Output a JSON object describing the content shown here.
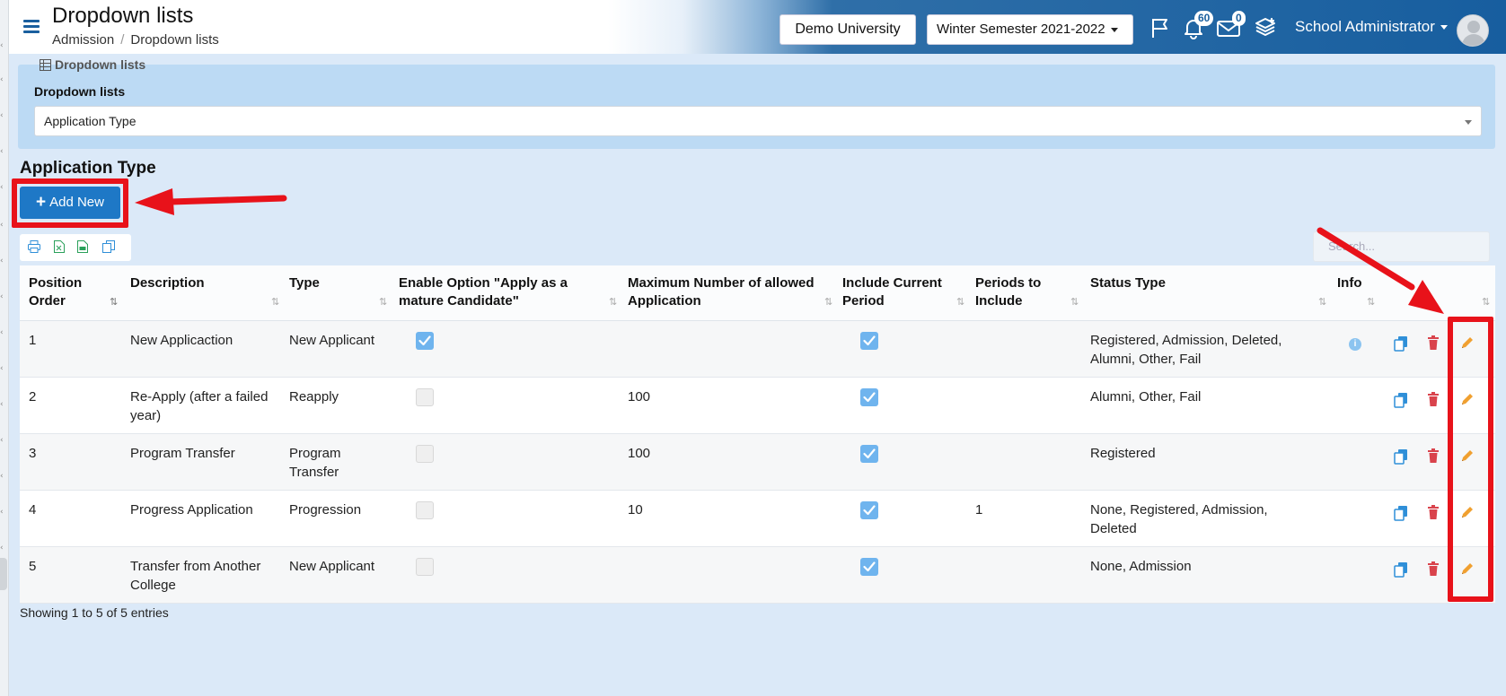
{
  "header": {
    "title": "Dropdown lists",
    "breadcrumb": [
      "Admission",
      "Dropdown lists"
    ],
    "university": "Demo University",
    "semester": "Winter Semester 2021-2022",
    "notifications_count": "60",
    "messages_count": "0",
    "user_name": "School Administrator"
  },
  "panel": {
    "caption": "Dropdown lists",
    "field_label": "Dropdown lists",
    "selected_value": "Application Type"
  },
  "section_title": "Application Type",
  "add_button_label": "Add New",
  "search_placeholder": "Search...",
  "table": {
    "columns": [
      "Position Order",
      "Description",
      "Type",
      "Enable Option \"Apply as a mature Candidate\"",
      "Maximum Number of allowed Application",
      "Include Current Period",
      "Periods to Include",
      "Status Type",
      "Info"
    ],
    "rows": [
      {
        "order": "1",
        "description": "New Applicaction",
        "type": "New Applicant",
        "mature": true,
        "max": "",
        "current": true,
        "periods": "",
        "status": "Registered, Admission, Deleted, Alumni, Other, Fail",
        "info": true
      },
      {
        "order": "2",
        "description": "Re-Apply (after a failed year)",
        "type": "Reapply",
        "mature": false,
        "max": "100",
        "current": true,
        "periods": "",
        "status": "Alumni, Other, Fail",
        "info": false
      },
      {
        "order": "3",
        "description": "Program Transfer",
        "type": "Program Transfer",
        "mature": false,
        "max": "100",
        "current": true,
        "periods": "",
        "status": "Registered",
        "info": false
      },
      {
        "order": "4",
        "description": "Progress Application",
        "type": "Progression",
        "mature": false,
        "max": "10",
        "current": true,
        "periods": "1",
        "status": "None, Registered, Admission, Deleted",
        "info": false
      },
      {
        "order": "5",
        "description": "Transfer from Another College",
        "type": "New Applicant",
        "mature": false,
        "max": "",
        "current": true,
        "periods": "",
        "status": "None, Admission",
        "info": false
      }
    ]
  },
  "footer": "Showing 1 to 5 of 5 entries",
  "colors": {
    "header_blue": "#175e9f",
    "accent": "#1e78c6",
    "highlight_red": "#e8121a",
    "checkbox_on": "#6fb4ee",
    "edit_orange": "#f0a030",
    "delete_red": "#d9434c",
    "copy_blue": "#2f8fd8"
  }
}
